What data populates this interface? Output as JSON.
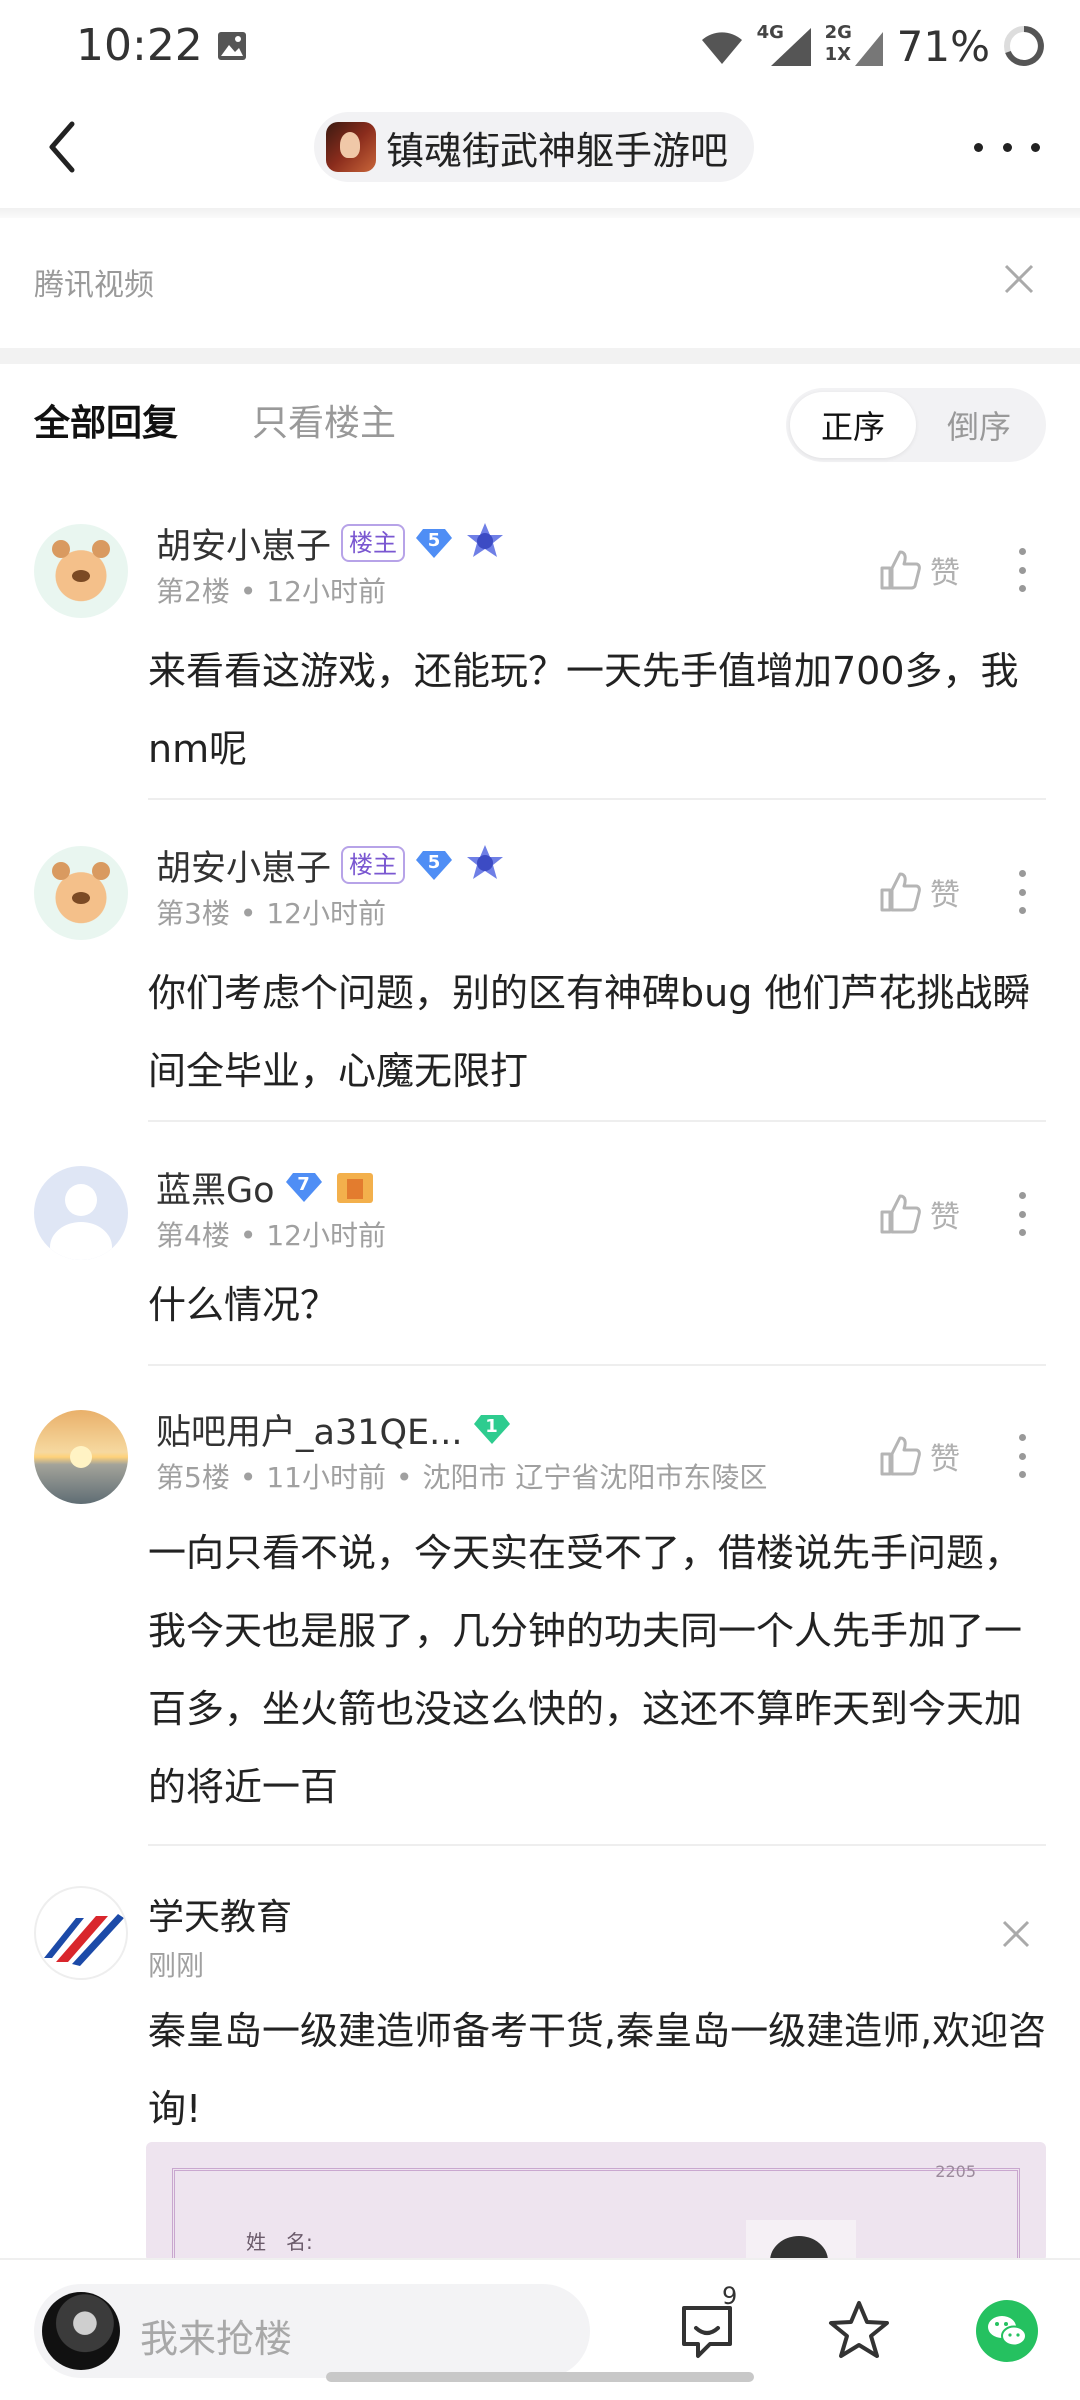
{
  "status_bar": {
    "time": "10:22",
    "network_1": "4G",
    "network_2": "2G",
    "network_2_sub": "1X",
    "battery": "71%"
  },
  "nav": {
    "forum_name": "镇魂街武神躯手游吧"
  },
  "source": {
    "label": "腾讯视频"
  },
  "tabs": {
    "all_replies": "全部回复",
    "owner_only": "只看楼主",
    "sort_asc": "正序",
    "sort_desc": "倒序"
  },
  "posts": [
    {
      "username": "胡安小崽子",
      "owner_badge": "楼主",
      "level": "5",
      "medal": "1",
      "floor": "第2楼",
      "time": "12小时前",
      "location": "",
      "like_label": "赞",
      "content": "来看看这游戏，还能玩？一天先手值增加700多，我nm呢"
    },
    {
      "username": "胡安小崽子",
      "owner_badge": "楼主",
      "level": "5",
      "medal": "1",
      "floor": "第3楼",
      "time": "12小时前",
      "location": "",
      "like_label": "赞",
      "content": "你们考虑个问题，别的区有神碑bug 他们芦花挑战瞬间全毕业，心魔无限打"
    },
    {
      "username": "蓝黑Go",
      "owner_badge": "",
      "level": "7",
      "medal": "1",
      "floor": "第4楼",
      "time": "12小时前",
      "location": "",
      "like_label": "赞",
      "content": "什么情况？"
    },
    {
      "username": "贴吧用户_a31QE...",
      "owner_badge": "",
      "level": "1",
      "medal": "",
      "floor": "第5楼",
      "time": "11小时前",
      "location": "沈阳市 辽宁省沈阳市东陵区",
      "like_label": "赞",
      "content": "一向只看不说，今天实在受不了，借楼说先手问题，我今天也是服了，几分钟的功夫同一个人先手加了一百多，坐火箭也没这么快的，这还不算昨天到今天加的将近一百"
    }
  ],
  "ad": {
    "name": "学天教育",
    "time": "刚刚",
    "text": "秦皇岛一级建造师备考干货,秦皇岛一级建造师,欢迎咨询!",
    "image_label": "姓　名:",
    "image_number": "2205"
  },
  "bottom_bar": {
    "reply_placeholder": "我来抢楼",
    "comment_count": "9"
  },
  "colors": {
    "accent_green": "#25c160",
    "owner_badge": "#7a57d1",
    "level_badge_blue": "#4f8ef5",
    "level_badge_green": "#2ecc8f"
  }
}
